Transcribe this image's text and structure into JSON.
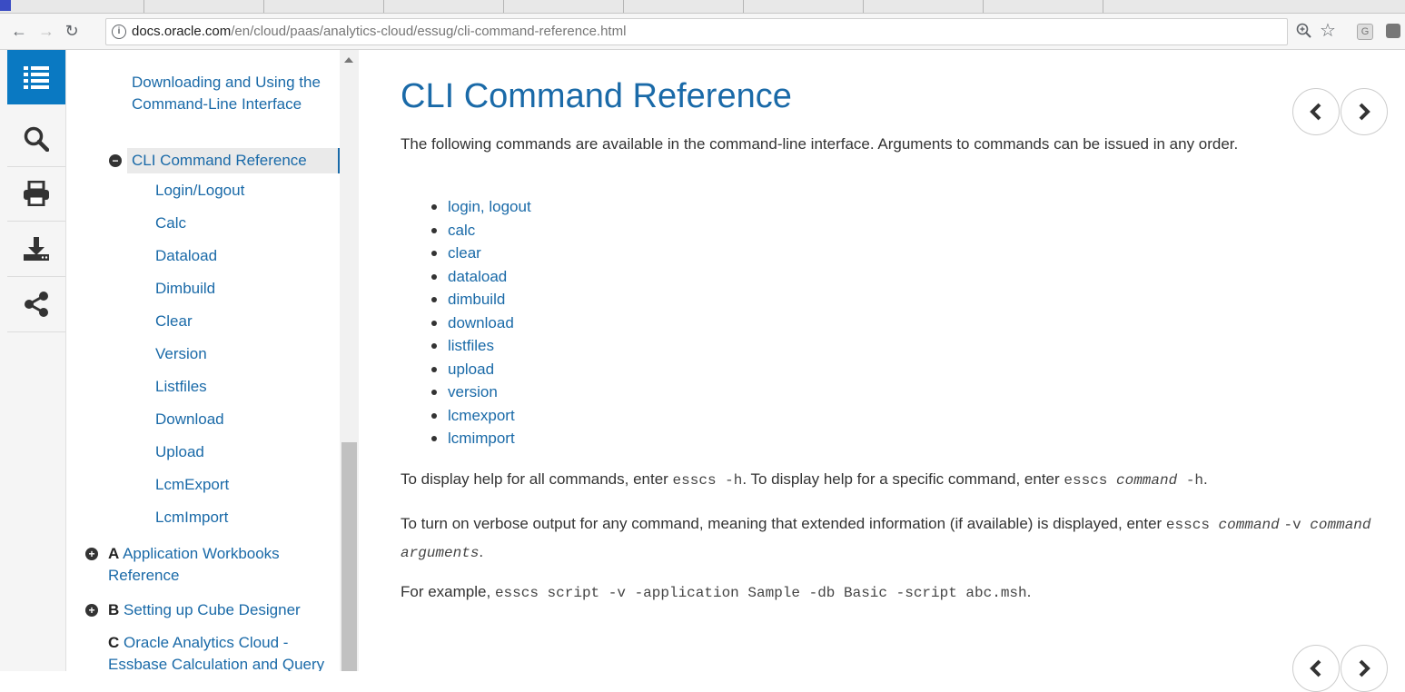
{
  "browser": {
    "url_host": "docs.oracle.com",
    "url_path": "/en/cloud/paas/analytics-cloud/essug/cli-command-reference.html"
  },
  "rail": {
    "icons": [
      "toc-icon",
      "search-icon",
      "print-icon",
      "download-icon",
      "share-icon"
    ]
  },
  "toc": {
    "items": [
      {
        "label": "Downloading and Using the Command-Line Interface"
      },
      {
        "label": "CLI Command Reference"
      },
      {
        "label": "Login/Logout"
      },
      {
        "label": "Calc"
      },
      {
        "label": "Dataload"
      },
      {
        "label": "Dimbuild"
      },
      {
        "label": "Clear"
      },
      {
        "label": "Version"
      },
      {
        "label": "Listfiles"
      },
      {
        "label": "Download"
      },
      {
        "label": "Upload"
      },
      {
        "label": "LcmExport"
      },
      {
        "label": "LcmImport"
      }
    ],
    "appendix_a": {
      "letter": "A",
      "label": "Application Workbooks Reference"
    },
    "appendix_b": {
      "letter": "B",
      "label": "Setting up Cube Designer"
    },
    "appendix_c": {
      "letter": "C",
      "label": "Oracle Analytics Cloud - Essbase Calculation and Query"
    }
  },
  "page": {
    "title": "CLI Command Reference",
    "intro": "The following commands are available in the command-line interface. Arguments to commands can be issued in any order.",
    "commands": [
      "login, logout",
      "calc",
      "clear",
      "dataload",
      "dimbuild",
      "download",
      "listfiles",
      "upload",
      "version",
      "lcmexport",
      "lcmimport"
    ],
    "help_text_1": "To display help for all commands, enter ",
    "help_code_1": "esscs -h",
    "help_text_2": ". To display help for a specific command, enter ",
    "help_code_2a": "esscs ",
    "help_code_2b": "command",
    "help_code_2c": " -h",
    "help_text_3": ".",
    "verbose_text_1": "To turn on verbose output for any command, meaning that extended information (if available) is displayed, enter ",
    "verbose_code_a": "esscs ",
    "verbose_code_b": "command",
    "verbose_code_c": "-v ",
    "verbose_code_d": "command arguments",
    "verbose_text_2": ".",
    "example_text_1": "For example, ",
    "example_code": "esscs script -v -application Sample -db Basic -script abc.msh",
    "example_text_2": "."
  }
}
